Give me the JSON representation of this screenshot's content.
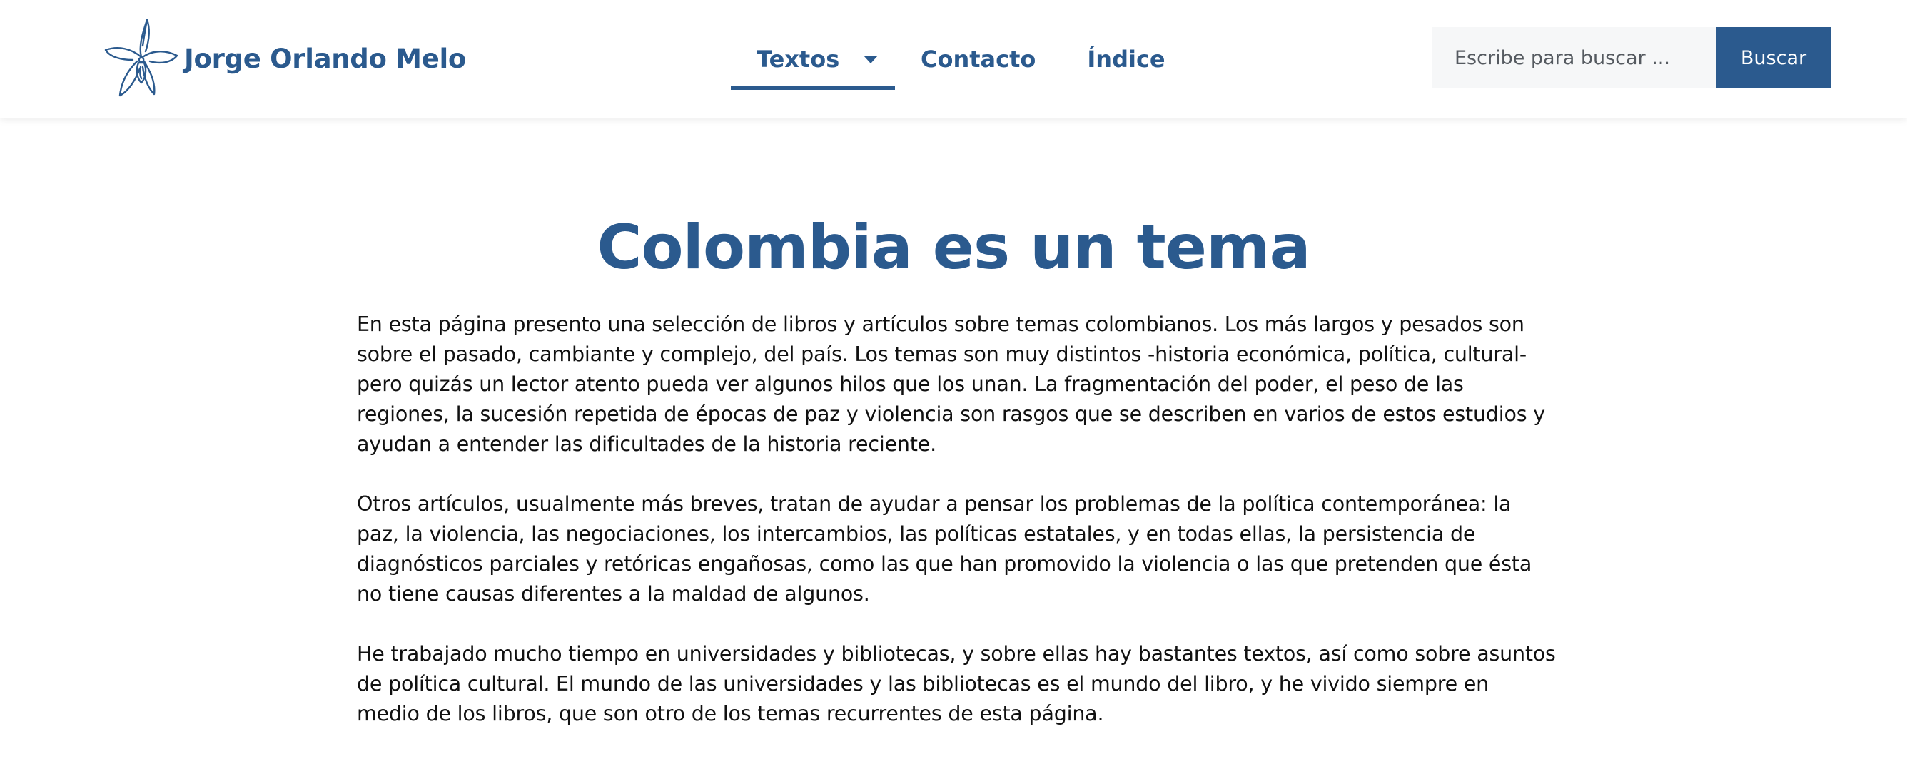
{
  "header": {
    "site_name": "Jorge Orlando Melo",
    "logo_icon": "orchid-flower-icon",
    "nav": {
      "textos": "Textos",
      "contacto": "Contacto",
      "indice": "Índice"
    },
    "search": {
      "placeholder": "Escribe para buscar ...",
      "value": "",
      "button_label": "Buscar"
    }
  },
  "main": {
    "title": "Colombia es un tema",
    "paragraphs": [
      "En esta página presento una selección de libros y artículos sobre temas colombianos. Los más largos y pesados son sobre el pasado, cambiante y complejo, del país. Los temas son muy distintos -historia económica, política, cultural- pero quizás un lector atento pueda ver algunos hilos que los unan. La fragmentación del poder, el peso de las regiones, la sucesión repetida de épocas de paz y violencia son rasgos que se describen en varios de estos estudios y ayudan a entender las dificultades de la historia reciente.",
      "Otros artículos, usualmente más breves, tratan de ayudar a pensar los problemas de la política contemporánea: la paz, la violencia, las negociaciones, los intercambios, las políticas estatales, y en todas ellas, la persistencia de diagnósticos parciales y retóricas engañosas, como las que han promovido la violencia o las que pretenden que ésta no tiene causas diferentes a la maldad de algunos.",
      "He trabajado mucho tiempo en universidades y bibliotecas, y sobre ellas hay bastantes textos, así como sobre asuntos de política cultural. El mundo de las universidades y las bibliotecas es el mundo del libro, y he vivido siempre en medio de los libros, que son otro de los temas recurrentes de esta página."
    ]
  },
  "colors": {
    "brand": "#2b5a8e",
    "text": "#111111",
    "search_bg": "#f6f7f8"
  }
}
